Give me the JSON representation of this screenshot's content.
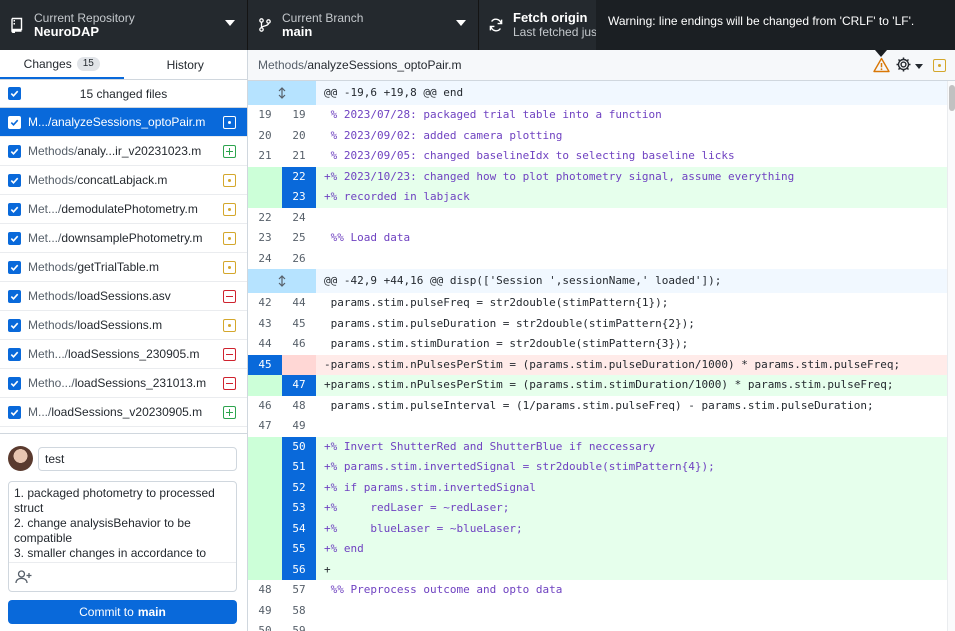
{
  "toolbar": {
    "repo_label": "Current Repository",
    "repo_name": "NeuroDAP",
    "branch_label": "Current Branch",
    "branch_name": "main",
    "fetch_title": "Fetch origin",
    "fetch_subtitle": "Last fetched jus"
  },
  "warning": {
    "text": "Warning: line endings will be changed from 'CRLF' to 'LF'."
  },
  "tabs": {
    "changes_label": "Changes",
    "changes_count": "15",
    "history_label": "History"
  },
  "changes_header": "15 changed files",
  "files": [
    {
      "dir": "",
      "name": "M.../analyzeSessions_optoPair.m",
      "status": "modified",
      "selected": true
    },
    {
      "dir": "Methods/",
      "name": "analy...ir_v20231023.m",
      "status": "added"
    },
    {
      "dir": "Methods/",
      "name": "concatLabjack.m",
      "status": "modified"
    },
    {
      "dir": "Met.../",
      "name": "demodulatePhotometry.m",
      "status": "modified"
    },
    {
      "dir": "Met.../",
      "name": "downsamplePhotometry.m",
      "status": "modified"
    },
    {
      "dir": "Methods/",
      "name": "getTrialTable.m",
      "status": "modified"
    },
    {
      "dir": "Methods/",
      "name": "loadSessions.asv",
      "status": "deleted"
    },
    {
      "dir": "Methods/",
      "name": "loadSessions.m",
      "status": "modified"
    },
    {
      "dir": "Meth.../",
      "name": "loadSessions_230905.m",
      "status": "deleted"
    },
    {
      "dir": "Metho.../",
      "name": "loadSessions_231013.m",
      "status": "deleted"
    },
    {
      "dir": "M.../",
      "name": "loadSessions_v20230905.m",
      "status": "added"
    }
  ],
  "commit": {
    "summary_value": "test",
    "description": "1. packaged photometry to processed struct\n2. change analysisBehavior to be compatible\n3. smaller changes in accordance to",
    "button_prefix": "Commit to",
    "button_branch": "main"
  },
  "diff": {
    "path_dir": "Methods/",
    "path_file": "analyzeSessions_optoPair.m",
    "lines": [
      {
        "type": "hunk",
        "old": "",
        "new": "",
        "code": "@@ -19,6 +19,8 @@ end"
      },
      {
        "type": "ctx",
        "old": "19",
        "new": "19",
        "code": " % 2023/07/28: packaged trial table into a function"
      },
      {
        "type": "ctx",
        "old": "20",
        "new": "20",
        "code": " % 2023/09/02: added camera plotting"
      },
      {
        "type": "ctx",
        "old": "21",
        "new": "21",
        "code": " % 2023/09/05: changed baselineIdx to selecting baseline licks"
      },
      {
        "type": "add",
        "old": "",
        "new": "22",
        "code": "+% 2023/10/23: changed how to plot photometry signal, assume everything"
      },
      {
        "type": "add",
        "old": "",
        "new": "23",
        "code": "+% recorded in labjack"
      },
      {
        "type": "ctx",
        "old": "22",
        "new": "24",
        "code": ""
      },
      {
        "type": "ctx",
        "old": "23",
        "new": "25",
        "code": " %% Load data"
      },
      {
        "type": "ctx",
        "old": "24",
        "new": "26",
        "code": ""
      },
      {
        "type": "hunk",
        "old": "",
        "new": "",
        "code": "@@ -42,9 +44,16 @@ disp(['Session ',sessionName,' loaded']);"
      },
      {
        "type": "ctx",
        "old": "42",
        "new": "44",
        "code": " params.stim.pulseFreq = str2double(stimPattern{1});"
      },
      {
        "type": "ctx",
        "old": "43",
        "new": "45",
        "code": " params.stim.pulseDuration = str2double(stimPattern{2});"
      },
      {
        "type": "ctx",
        "old": "44",
        "new": "46",
        "code": " params.stim.stimDuration = str2double(stimPattern{3});"
      },
      {
        "type": "del",
        "old": "45",
        "new": "",
        "code": "-params.stim.nPulsesPerStim = (params.stim.pulseDuration/1000) * params.stim.pulseFreq;"
      },
      {
        "type": "add",
        "old": "",
        "new": "47",
        "code": "+params.stim.nPulsesPerStim = (params.stim.stimDuration/1000) * params.stim.pulseFreq;"
      },
      {
        "type": "ctx",
        "old": "46",
        "new": "48",
        "code": " params.stim.pulseInterval = (1/params.stim.pulseFreq) - params.stim.pulseDuration;"
      },
      {
        "type": "ctx",
        "old": "47",
        "new": "49",
        "code": ""
      },
      {
        "type": "add",
        "old": "",
        "new": "50",
        "code": "+% Invert ShutterRed and ShutterBlue if neccessary"
      },
      {
        "type": "add",
        "old": "",
        "new": "51",
        "code": "+% params.stim.invertedSignal = str2double(stimPattern{4});"
      },
      {
        "type": "add",
        "old": "",
        "new": "52",
        "code": "+% if params.stim.invertedSignal"
      },
      {
        "type": "add",
        "old": "",
        "new": "53",
        "code": "+%     redLaser = ~redLaser;"
      },
      {
        "type": "add",
        "old": "",
        "new": "54",
        "code": "+%     blueLaser = ~blueLaser;"
      },
      {
        "type": "add",
        "old": "",
        "new": "55",
        "code": "+% end"
      },
      {
        "type": "add",
        "old": "",
        "new": "56",
        "code": "+"
      },
      {
        "type": "ctx",
        "old": "48",
        "new": "57",
        "code": " %% Preprocess outcome and opto data"
      },
      {
        "type": "ctx",
        "old": "49",
        "new": "58",
        "code": ""
      },
      {
        "type": "ctx",
        "old": "50",
        "new": "59",
        "code": ""
      }
    ]
  }
}
